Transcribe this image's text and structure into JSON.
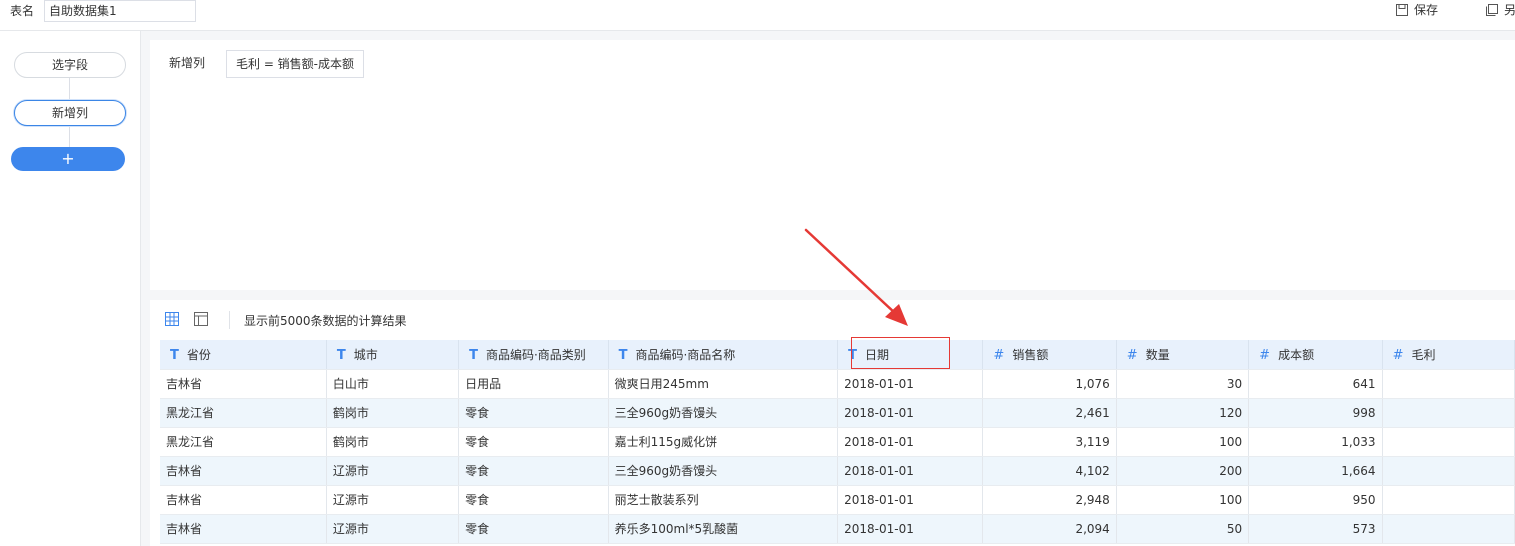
{
  "topbar": {
    "table_name_label": "表名",
    "table_name_value": "自助数据集1",
    "save_label": "保存",
    "save_as_label": "另"
  },
  "steps": {
    "items": [
      {
        "label": "选字段",
        "active": false
      },
      {
        "label": "新增列",
        "active": true
      }
    ],
    "add_label": "+"
  },
  "config": {
    "label": "新增列",
    "formula": "毛利 = 销售额-成本额"
  },
  "preview": {
    "info": "显示前5000条数据的计算结果",
    "columns": [
      {
        "type": "T",
        "name": "省份"
      },
      {
        "type": "T",
        "name": "城市"
      },
      {
        "type": "T",
        "name": "商品编码·商品类别"
      },
      {
        "type": "T",
        "name": "商品编码·商品名称"
      },
      {
        "type": "T",
        "name": "日期"
      },
      {
        "type": "#",
        "name": "销售额"
      },
      {
        "type": "#",
        "name": "数量"
      },
      {
        "type": "#",
        "name": "成本额"
      },
      {
        "type": "#",
        "name": "毛利"
      }
    ],
    "rows": [
      [
        "吉林省",
        "白山市",
        "日用品",
        "微爽日用245mm",
        "2018-01-01",
        "1,076",
        "30",
        "641",
        ""
      ],
      [
        "黑龙江省",
        "鹤岗市",
        "零食",
        "三全960g奶香馒头",
        "2018-01-01",
        "2,461",
        "120",
        "998",
        ""
      ],
      [
        "黑龙江省",
        "鹤岗市",
        "零食",
        "嘉士利115g威化饼",
        "2018-01-01",
        "3,119",
        "100",
        "1,033",
        ""
      ],
      [
        "吉林省",
        "辽源市",
        "零食",
        "三全960g奶香馒头",
        "2018-01-01",
        "4,102",
        "200",
        "1,664",
        ""
      ],
      [
        "吉林省",
        "辽源市",
        "零食",
        "丽芝士散装系列",
        "2018-01-01",
        "2,948",
        "100",
        "950",
        ""
      ],
      [
        "吉林省",
        "辽源市",
        "零食",
        "养乐多100ml*5乳酸菌",
        "2018-01-01",
        "2,094",
        "50",
        "573",
        ""
      ]
    ]
  },
  "colors": {
    "accent": "#3d86ec",
    "header_bg": "#e8f1fc",
    "alt_row_bg": "#eef6fc",
    "annotation": "#e53935"
  },
  "icons": {
    "save": "save-icon",
    "save_as": "save-as-icon",
    "grid_view": "grid-view-icon",
    "detail_view": "layout-view-icon",
    "text_type": "text-type-icon",
    "number_type": "number-type-icon"
  }
}
